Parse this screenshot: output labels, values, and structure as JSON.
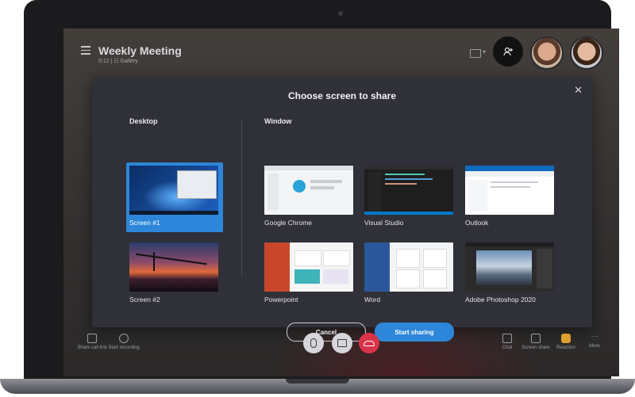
{
  "meeting": {
    "title": "Weekly Meeting",
    "subtitle": "0:12  |  ☷ Gallery"
  },
  "dialog": {
    "title": "Choose screen to share",
    "close_glyph": "✕",
    "desktop_label": "Desktop",
    "window_label": "Window",
    "desktop_items": [
      {
        "label": "Screen #1",
        "selected": true
      },
      {
        "label": "Screen #2",
        "selected": false
      }
    ],
    "window_items": [
      {
        "label": "Google Chrome"
      },
      {
        "label": "Visual Studio"
      },
      {
        "label": "Outlook"
      },
      {
        "label": "Powerpoint"
      },
      {
        "label": "Word"
      },
      {
        "label": "Adobe Photoshop 2020"
      }
    ],
    "cancel_label": "Cancel",
    "share_label": "Start sharing"
  },
  "toolbar": {
    "left": [
      {
        "label": "Share call link",
        "icon": "share-icon"
      },
      {
        "label": "Start recording",
        "icon": "record-icon"
      }
    ],
    "right": [
      {
        "label": "Chat",
        "icon": "chat-icon"
      },
      {
        "label": "Screen share",
        "icon": "screen-share-icon"
      },
      {
        "label": "Reaction",
        "icon": "reaction-icon"
      },
      {
        "label": "More",
        "icon": "more-icon"
      }
    ]
  },
  "colors": {
    "accent": "#2d86d9",
    "hangup": "#d9344a",
    "dialog_bg": "#2f3038"
  }
}
